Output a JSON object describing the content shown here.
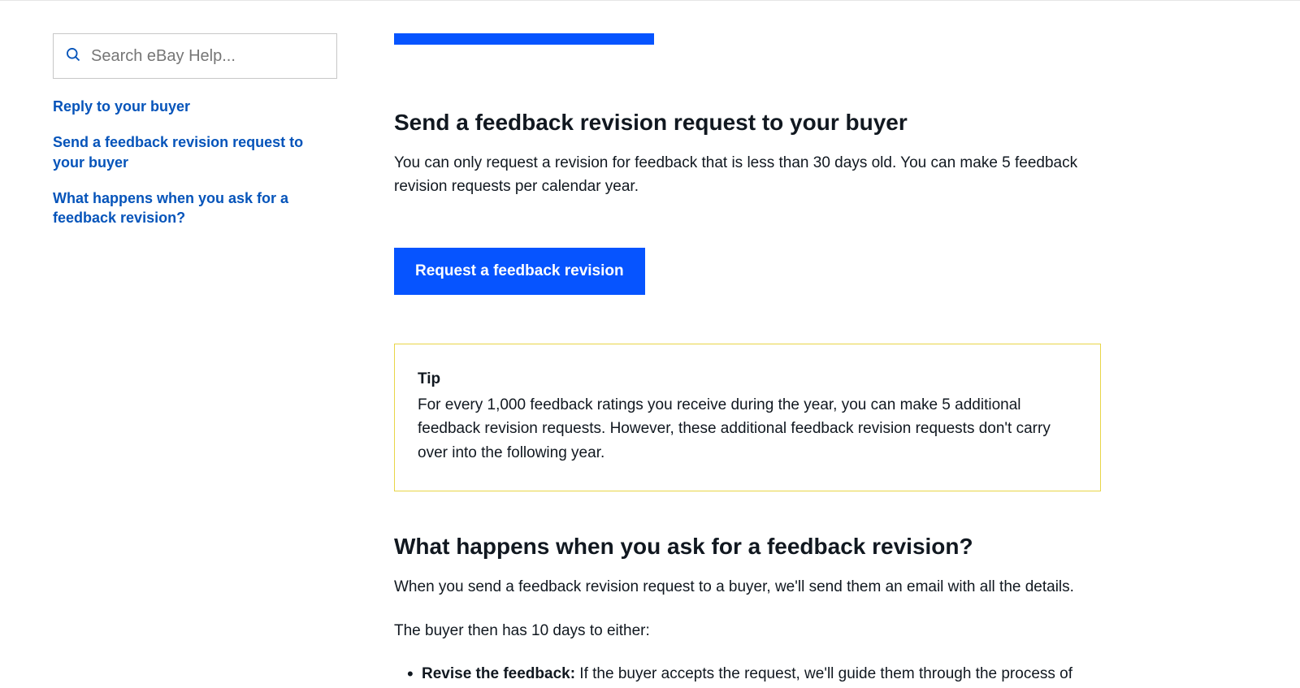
{
  "sidebar": {
    "search_placeholder": "Search eBay Help...",
    "links": [
      "Reply to your buyer",
      "Send a feedback revision request to your buyer",
      "What happens when you ask for a feedback revision?"
    ]
  },
  "main": {
    "section1": {
      "heading": "Send a feedback revision request to your buyer",
      "para": "You can only request a revision for feedback that is less than 30 days old. You can make 5 feedback revision requests per calendar year.",
      "button": "Request a feedback revision"
    },
    "tip": {
      "title": "Tip",
      "body": "For every 1,000 feedback ratings you receive during the year, you can make 5 additional feedback revision requests. However, these additional feedback revision requests don't carry over into the following year."
    },
    "section2": {
      "heading": "What happens when you ask for a feedback revision?",
      "para1": "When you send a feedback revision request to a buyer, we'll send them an email with all the details.",
      "para2": "The buyer then has 10 days to either:",
      "bullet_strong": "Revise the feedback:",
      "bullet_rest": " If the buyer accepts the request, we'll guide them through the process of"
    }
  }
}
